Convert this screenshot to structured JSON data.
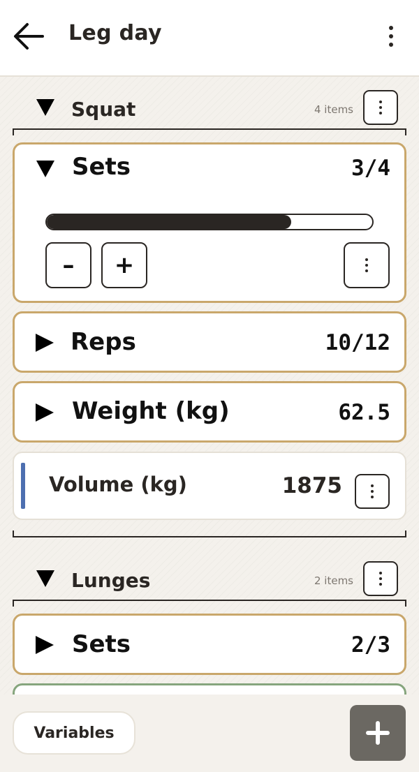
{
  "header": {
    "title": "Leg day",
    "back_icon": "arrow-left-icon",
    "menu_icon": "more-vertical-icon"
  },
  "groups": [
    {
      "name": "Squat",
      "count": "4 items",
      "expanded": true,
      "cards": [
        {
          "title": "Sets",
          "value": "3/4",
          "expanded": true,
          "progress": 0.75,
          "controls": {
            "minus": "–",
            "plus": "+"
          }
        },
        {
          "title": "Reps",
          "value": "10/12",
          "expanded": false
        },
        {
          "title": "Weight (kg)",
          "value": "62.5",
          "expanded": false
        }
      ],
      "variable": {
        "name": "Volume (kg)",
        "value": "1875",
        "accent": "#4d6fb0"
      }
    },
    {
      "name": "Lunges",
      "count": "2 items",
      "expanded": true,
      "cards": [
        {
          "title": "Sets",
          "value": "2/3",
          "expanded": false
        }
      ]
    }
  ],
  "footer": {
    "variables_label": "Variables",
    "fab_icon": "plus-icon"
  },
  "colors": {
    "card_border": "#c9a76b",
    "var_accent": "#4d6fb0",
    "fab": "#6b6862",
    "next_card_border": "#86a57d"
  }
}
